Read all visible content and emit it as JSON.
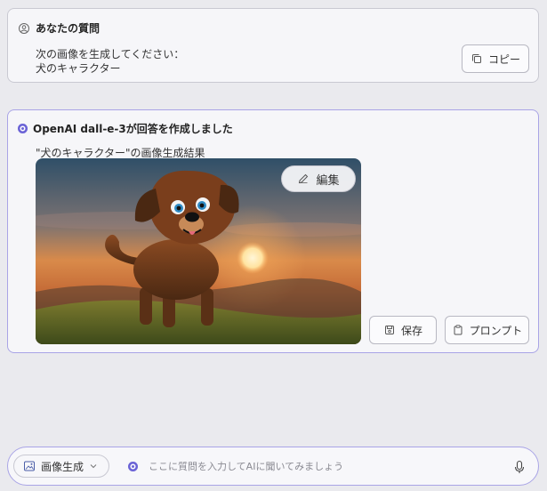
{
  "question": {
    "header": "あなたの質問",
    "lines": [
      "次の画像を生成してください：",
      "犬のキャラクター"
    ],
    "copy_label": "コピー",
    "icons": {
      "header": "person-circle-icon",
      "copy": "copy-icon"
    }
  },
  "answer": {
    "header": "OpenAI dall-e-3が回答を作成しました",
    "caption": "\"犬のキャラクター\"の画像生成結果",
    "edit_label": "編集",
    "save_label": "保存",
    "prompt_label": "プロンプト",
    "icons": {
      "header": "ai-dot-icon",
      "edit": "pencil-icon",
      "save": "save-icon",
      "prompt": "clipboard-icon"
    },
    "image_alt": "sunset dog character illustration"
  },
  "input_bar": {
    "mode_label": "画像生成",
    "placeholder": "ここに質問を入力してAIに聞いてみましょう",
    "value": "",
    "icons": {
      "mode": "image-icon",
      "chevron": "chevron-down-icon",
      "ai": "ai-dot-icon",
      "mic": "microphone-icon"
    }
  },
  "colors": {
    "accent": "#6b63d6",
    "card_border_active": "#a9a4e6"
  }
}
